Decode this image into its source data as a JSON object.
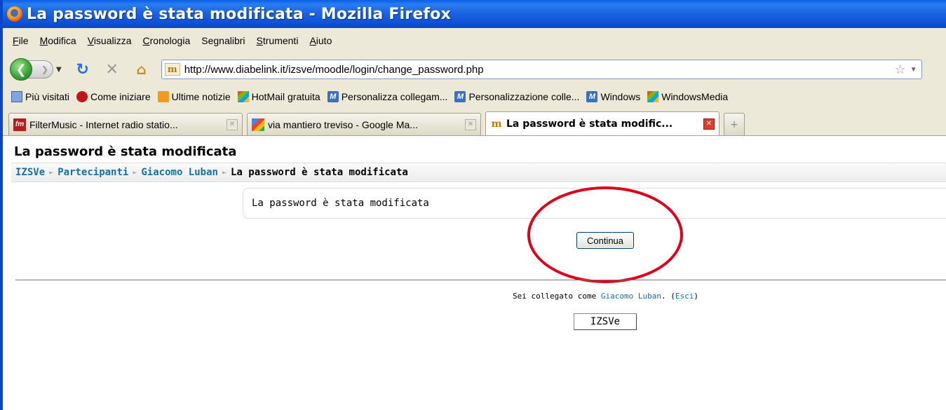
{
  "window": {
    "title": "La password è stata modificata - Mozilla Firefox"
  },
  "menu": [
    "File",
    "Modifica",
    "Visualizza",
    "Cronologia",
    "Segnalibri",
    "Strumenti",
    "Aiuto"
  ],
  "navigation": {
    "url": "http://www.diabelink.it/izsve/moodle/login/change_password.php"
  },
  "bookmarks": [
    {
      "label": "Più visitati",
      "icon": "search-icon"
    },
    {
      "label": "Come iniziare",
      "icon": "firefox-icon"
    },
    {
      "label": "Ultime notizie",
      "icon": "rss-icon"
    },
    {
      "label": "HotMail gratuita",
      "icon": "windows-icon"
    },
    {
      "label": "Personalizza collegam...",
      "icon": "msn-icon"
    },
    {
      "label": "Personalizzazione colle...",
      "icon": "msn-icon"
    },
    {
      "label": "Windows",
      "icon": "msn-icon"
    },
    {
      "label": "WindowsMedia",
      "icon": "windows-icon"
    }
  ],
  "tabs": [
    {
      "label": "FilterMusic - Internet radio statio...",
      "active": false
    },
    {
      "label": "via mantiero treviso - Google Ma...",
      "active": false
    },
    {
      "label": "La password è stata modific...",
      "active": true
    }
  ],
  "page": {
    "heading": "La password è stata modificata",
    "breadcrumb": {
      "items": [
        "IZSVe",
        "Partecipanti",
        "Giacomo Luban"
      ],
      "current": "La password è stata modificata",
      "separator": "►"
    },
    "notice": "La password è stata modificata",
    "continue_button": "Continua",
    "footer": {
      "logged_in_prefix": "Sei collegato come ",
      "user": "Giacomo Luban",
      "after_user": ". (",
      "logout": "Esci",
      "suffix": ")"
    },
    "home_button": "IZSVe"
  },
  "annotation": {
    "ellipse_color": "#e0001a"
  }
}
